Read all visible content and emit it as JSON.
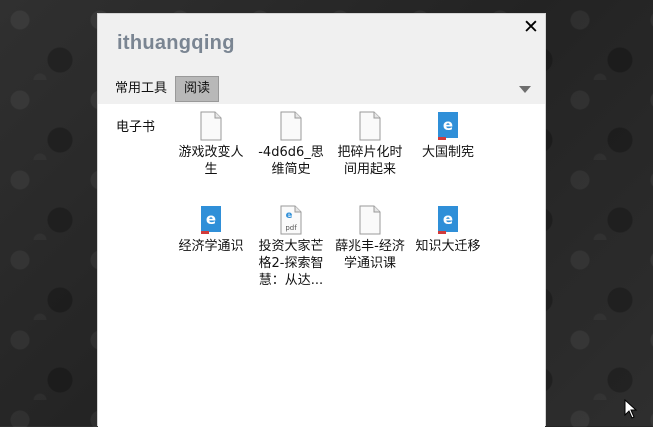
{
  "panel": {
    "title": "ithuangqing",
    "close_label": "✕",
    "tabs": [
      {
        "label": "常用工具",
        "active": false
      },
      {
        "label": "阅读",
        "active": true
      }
    ]
  },
  "sidebar": {
    "items": [
      {
        "label": "电子书"
      }
    ]
  },
  "files": [
    {
      "name": "游戏改变人生",
      "icon": "blank-document-icon"
    },
    {
      "name": "-4d6d6_思维简史",
      "icon": "blank-document-icon"
    },
    {
      "name": "把碎片化时间用起来",
      "icon": "blank-document-icon"
    },
    {
      "name": "大国制宪",
      "icon": "edge-document-icon"
    },
    {
      "name": "经济学通识",
      "icon": "edge-document-icon"
    },
    {
      "name": "投资大家芒格2-探索智慧：从达...",
      "icon": "pdf-document-icon"
    },
    {
      "name": "薛兆丰-经济学通识课",
      "icon": "blank-document-icon"
    },
    {
      "name": "知识大迁移",
      "icon": "edge-document-icon"
    }
  ],
  "pdf_badge": "pdf",
  "colors": {
    "accent_blue": "#2f8fd8",
    "title_gray": "#7a8592",
    "active_tab": "#b8b8b8"
  }
}
